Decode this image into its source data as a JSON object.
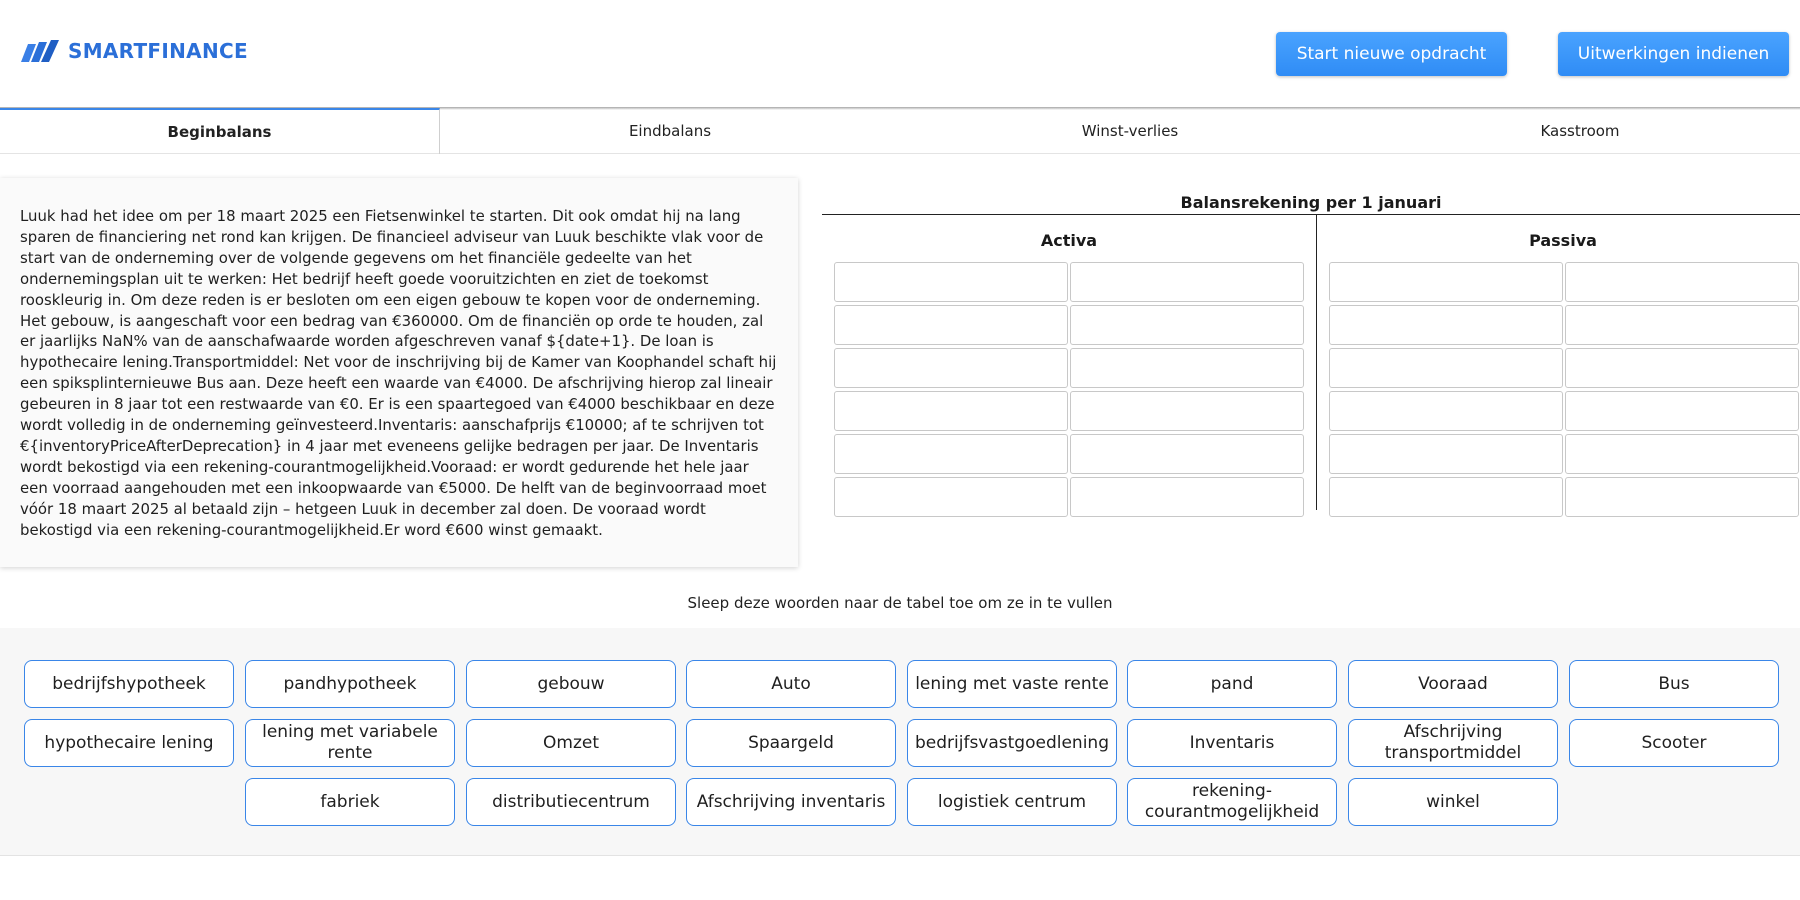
{
  "header": {
    "logo_text": "SMARTFINANCE",
    "logo_icon": "slanted-bars-logo-icon",
    "brand_color": "#2b6fd8",
    "buttons": {
      "start_new": "Start nieuwe opdracht",
      "submit": "Uitwerkingen indienen"
    },
    "button_color": "#3d97fb"
  },
  "tabs": [
    {
      "label": "Beginbalans",
      "active": true
    },
    {
      "label": "Eindbalans",
      "active": false
    },
    {
      "label": "Winst-verlies",
      "active": false
    },
    {
      "label": "Kasstroom",
      "active": false
    }
  ],
  "case_text": "Luuk had het idee om per 18 maart 2025 een Fietsenwinkel te starten. Dit ook omdat hij na lang sparen de financiering net rond kan krijgen. De financieel adviseur van Luuk beschikte vlak voor de start van de onderneming over de volgende gegevens om het financiële gedeelte van het ondernemingsplan uit te werken: Het bedrijf heeft goede vooruitzichten en ziet de toekomst rooskleurig in. Om deze reden is er besloten om een eigen gebouw te kopen voor de onderneming. Het gebouw, is aangeschaft voor een bedrag van €360000. Om de financiën op orde te houden, zal er jaarlijks NaN% van de aanschafwaarde worden afgeschreven vanaf ${date+1}. De loan is hypothecaire lening.Transportmiddel: Net voor de inschrijving bij de Kamer van Koophandel schaft hij een spiksplinternieuwe Bus aan. Deze heeft een waarde van €4000. De afschrijving hierop zal lineair gebeuren in 8 jaar tot een restwaarde van €0. Er is een spaartegoed van €4000 beschikbaar en deze wordt volledig in de onderneming geïnvesteerd.Inventaris: aanschafprijs €10000; af te schrijven tot €{inventoryPriceAfterDeprecation} in 4 jaar met eveneens gelijke bedragen per jaar. De Inventaris wordt bekostigd via een rekening-courantmogelijkheid.Vooraad: er wordt gedurende het hele jaar een voorraad aangehouden met een inkoopwaarde van €5000. De helft van de beginvoorraad moet vóór 18 maart 2025 al betaald zijn – hetgeen Luuk in december zal doen. De vooraad wordt bekostigd via een rekening-courantmogelijkheid.Er word €600 winst gemaakt.",
  "balance": {
    "title": "Balansrekening per 1 januari",
    "activa_label": "Activa",
    "passiva_label": "Passiva"
  },
  "instruction": "Sleep deze woorden naar de tabel toe om ze in te vullen",
  "word_bank": [
    "bedrijfshypotheek",
    "pandhypotheek",
    "gebouw",
    "Auto",
    "lening met vaste rente",
    "pand",
    "Vooraad",
    "Bus",
    "hypothecaire lening",
    "lening met variabele rente",
    "Omzet",
    "Spaargeld",
    "bedrijfsvastgoedlening",
    "Inventaris",
    "Afschrijving transportmiddel",
    "Scooter",
    "fabriek",
    "distributiecentrum",
    "Afschrijving inventaris",
    "logistiek centrum",
    "rekening-courantmogelijkheid",
    "winkel"
  ]
}
